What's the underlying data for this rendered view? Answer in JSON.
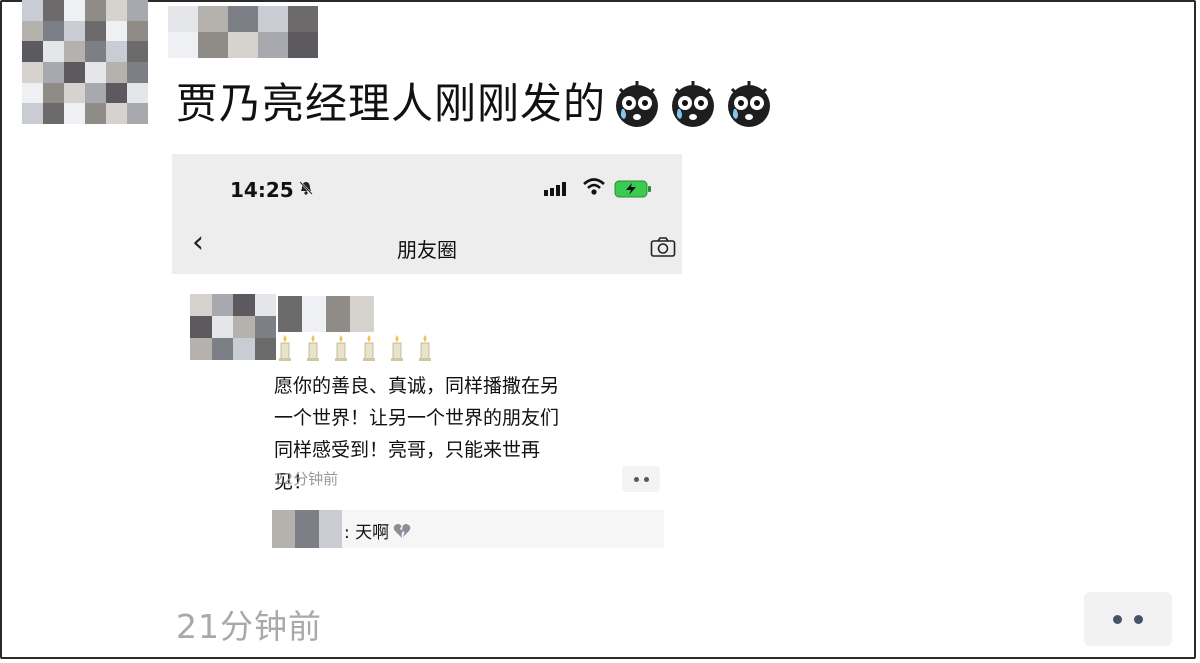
{
  "post": {
    "text": "贾乃亮经理人刚刚发的",
    "emoji": "crying-face-icon",
    "time": "21分钟前"
  },
  "embedded": {
    "status_time": "14:25",
    "nav_title": "朋友圈",
    "moment_text": "愿你的善良、真诚，同样播撒在另一个世界！让另一个世界的朋友们同样感受到！亮哥，只能来世再见！",
    "moment_time": "22分钟前",
    "comment_text": ": 天啊"
  },
  "colors": {
    "background": "#ffffff",
    "header_bg": "#ededed",
    "muted_text": "#a9a9a9",
    "battery_green": "#3ccb52"
  }
}
